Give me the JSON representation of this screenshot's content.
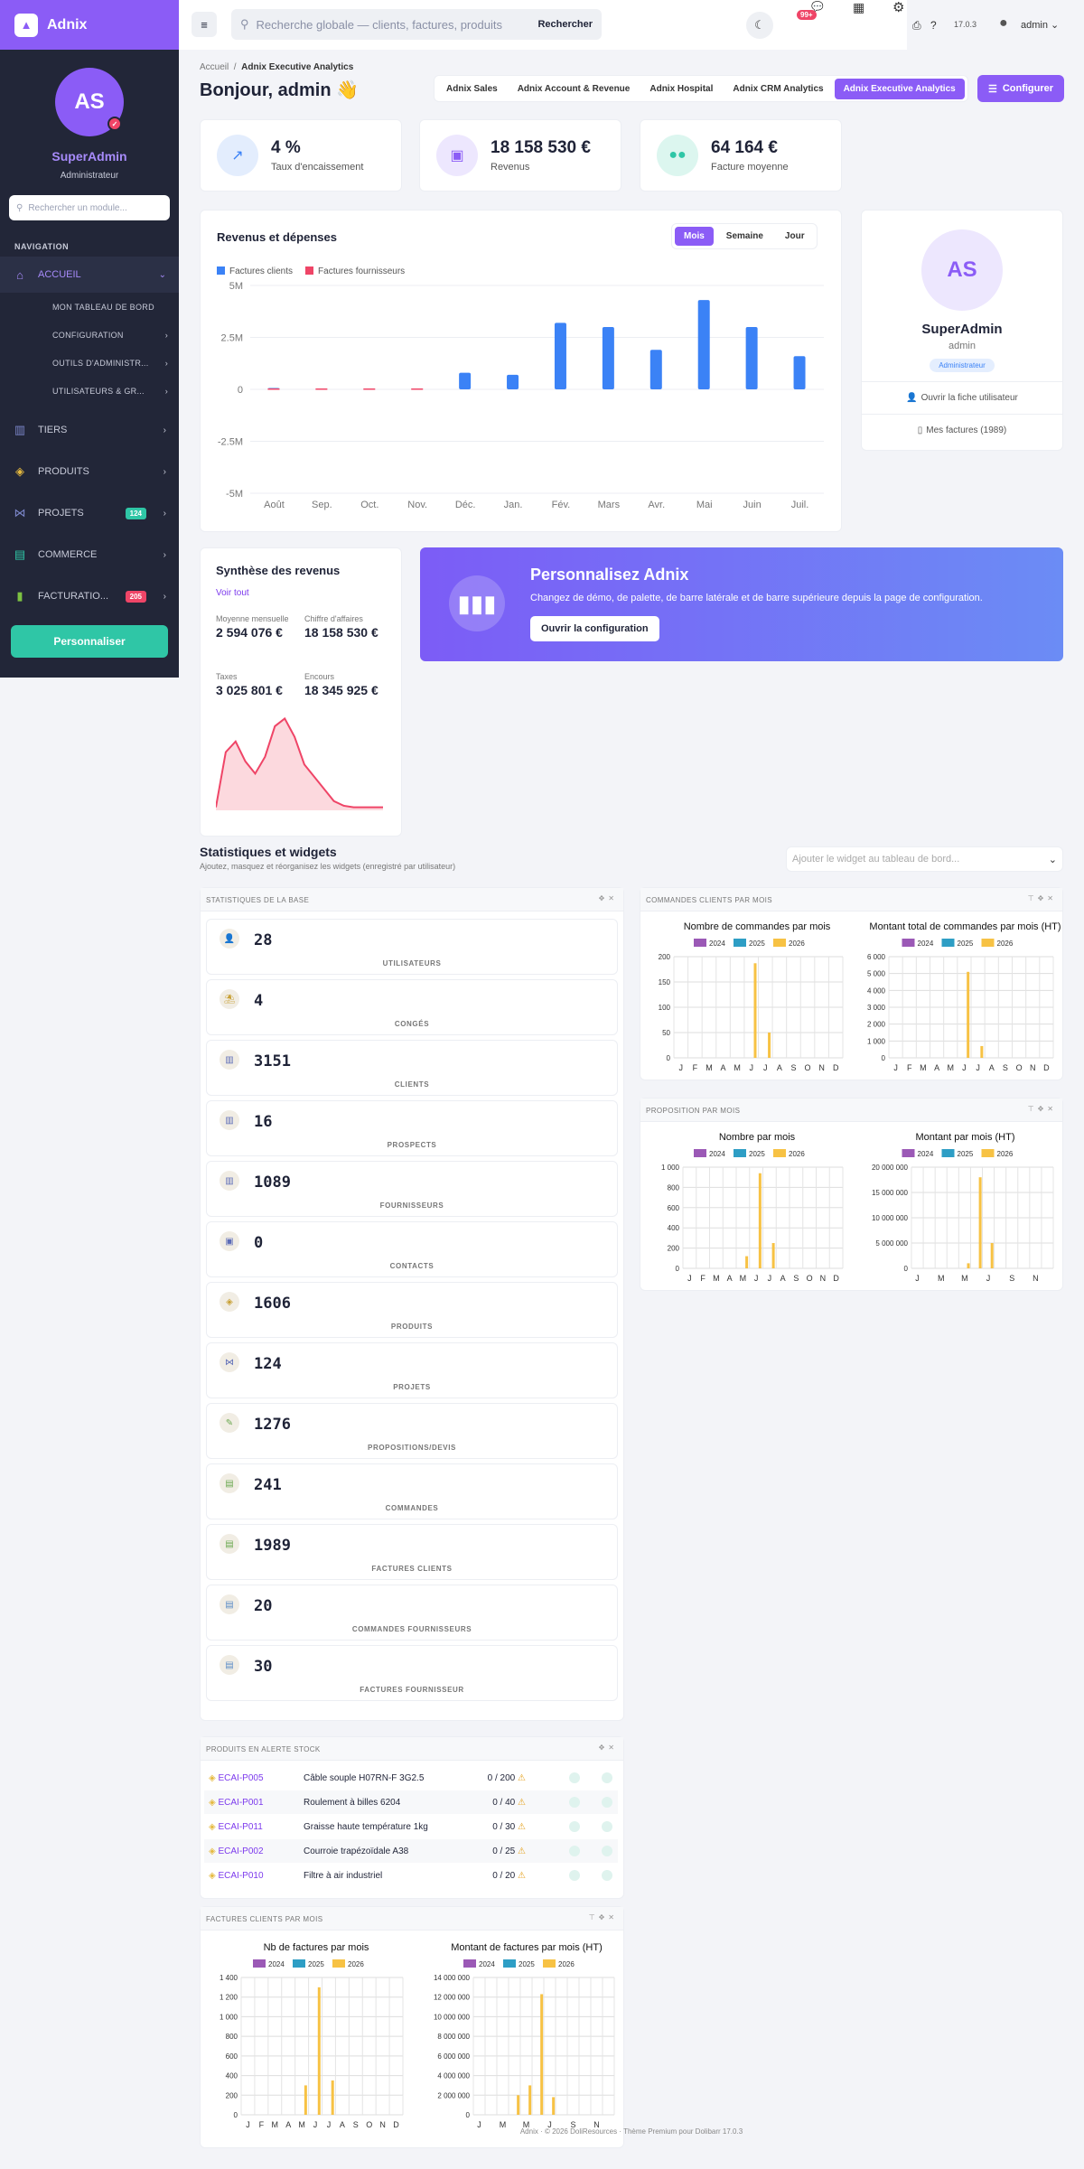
{
  "app": {
    "name": "Adnix"
  },
  "sidebar": {
    "avatar_initials": "AS",
    "user_name": "SuperAdmin",
    "user_role": "Administrateur",
    "search_placeholder": "Rechercher un module...",
    "section": "NAVIGATION",
    "items": [
      {
        "label": "ACCUEIL",
        "icon": "home-icon",
        "active": true
      },
      {
        "label": "TIERS",
        "icon": "building-icon"
      },
      {
        "label": "PRODUITS",
        "icon": "box-icon"
      },
      {
        "label": "PROJETS",
        "icon": "project-icon",
        "badge": "124"
      },
      {
        "label": "COMMERCE",
        "icon": "briefcase-icon"
      },
      {
        "label": "FACTURATIO...",
        "icon": "invoice-icon",
        "badge": "205"
      }
    ],
    "subitems": [
      "MON TABLEAU DE BORD",
      "CONFIGURATION",
      "OUTILS D'ADMINISTR...",
      "UTILISATEURS & GR..."
    ],
    "personalize_button": "Personnaliser"
  },
  "topbar": {
    "search_placeholder": "Recherche globale — clients, factures, produits",
    "search_button": "Rechercher",
    "notif_badge": "99+",
    "version": "17.0.3",
    "user": "admin"
  },
  "header": {
    "breadcrumb_home": "Accueil",
    "breadcrumb_current": "Adnix Executive Analytics",
    "greeting": "Bonjour, admin 👋",
    "tabs": [
      "Adnix Sales",
      "Adnix Account & Revenue",
      "Adnix Hospital",
      "Adnix CRM Analytics",
      "Adnix Executive Analytics"
    ],
    "configure_button": "Configurer"
  },
  "kpis": [
    {
      "value": "4 %",
      "label": "Taux d'encaissement",
      "color": "#3b82f6"
    },
    {
      "value": "18 158 530 €",
      "label": "Revenus",
      "color": "#8b5cf6"
    },
    {
      "value": "64 164 €",
      "label": "Facture moyenne",
      "color": "#2fc6a6"
    }
  ],
  "revenue_chart": {
    "title": "Revenus et dépenses",
    "periods": [
      "Mois",
      "Semaine",
      "Jour"
    ],
    "active_period": "Mois"
  },
  "chart_data": [
    {
      "type": "bar",
      "title": "Revenus et dépenses",
      "categories": [
        "Août",
        "Sep.",
        "Oct.",
        "Nov.",
        "Déc.",
        "Jan.",
        "Fév.",
        "Mars",
        "Avr.",
        "Mai",
        "Juin",
        "Juil."
      ],
      "series": [
        {
          "name": "Factures clients",
          "color": "#3b82f6",
          "values": [
            0.02,
            0,
            0,
            0,
            0.8,
            0.7,
            3.2,
            3.0,
            1.9,
            4.3,
            3.0,
            1.6
          ]
        },
        {
          "name": "Factures fournisseurs",
          "color": "#ef4567",
          "values": [
            0.02,
            0.02,
            0.02,
            0.02,
            0,
            0,
            0,
            0,
            0,
            0,
            0,
            0
          ]
        }
      ],
      "yticks": [
        "5M",
        "2.5M",
        "0",
        "-2.5M",
        "-5M"
      ],
      "ylim": [
        -5,
        5
      ],
      "unit": "M",
      "grid": true,
      "legend": "top-left"
    },
    {
      "type": "area",
      "title": "Synthèse des revenus",
      "values": [
        2,
        38,
        45,
        32,
        24,
        35,
        55,
        60,
        48,
        30,
        22,
        14,
        6,
        3,
        2,
        2,
        2,
        2
      ],
      "color": "#ef4567"
    },
    {
      "type": "bar",
      "title": "Nombre de commandes par mois",
      "categories": [
        "J",
        "F",
        "M",
        "A",
        "M",
        "J",
        "J",
        "A",
        "S",
        "O",
        "N",
        "D"
      ],
      "series": [
        {
          "name": "2024",
          "color": "#9b59b6",
          "values": [
            0,
            0,
            0,
            0,
            0,
            0,
            0,
            0,
            0,
            0,
            0,
            0
          ]
        },
        {
          "name": "2025",
          "color": "#2e9ec5",
          "values": [
            0,
            0,
            0,
            0,
            0,
            0,
            0,
            0,
            0,
            0,
            0,
            0
          ]
        },
        {
          "name": "2026",
          "color": "#f7c244",
          "values": [
            0,
            0,
            0,
            0,
            0,
            187,
            50,
            0,
            0,
            0,
            0,
            0
          ]
        }
      ],
      "yticks": [
        "200",
        "150",
        "100",
        "50",
        "0"
      ],
      "ylim": [
        0,
        200
      ]
    },
    {
      "type": "bar",
      "title": "Montant total de commandes par mois (HT)",
      "categories": [
        "J",
        "F",
        "M",
        "A",
        "M",
        "J",
        "J",
        "A",
        "S",
        "O",
        "N",
        "D"
      ],
      "series": [
        {
          "name": "2024",
          "color": "#9b59b6",
          "values": [
            0,
            0,
            0,
            0,
            0,
            0,
            0,
            0,
            0,
            0,
            0,
            0
          ]
        },
        {
          "name": "2025",
          "color": "#2e9ec5",
          "values": [
            0,
            0,
            0,
            0,
            0,
            0,
            0,
            0,
            0,
            0,
            0,
            0
          ]
        },
        {
          "name": "2026",
          "color": "#f7c244",
          "values": [
            0,
            0,
            0,
            0,
            0,
            5100,
            700,
            0,
            0,
            0,
            0,
            0
          ]
        }
      ],
      "yticks": [
        "6 000",
        "5 000",
        "4 000",
        "3 000",
        "2 000",
        "1 000",
        "0"
      ],
      "ylim": [
        0,
        6000
      ]
    },
    {
      "type": "bar",
      "title": "Nombre par mois",
      "categories": [
        "J",
        "F",
        "M",
        "A",
        "M",
        "J",
        "J",
        "A",
        "S",
        "O",
        "N",
        "D"
      ],
      "series": [
        {
          "name": "2024",
          "color": "#9b59b6",
          "values": [
            0,
            0,
            0,
            0,
            0,
            0,
            0,
            0,
            0,
            0,
            0,
            0
          ]
        },
        {
          "name": "2025",
          "color": "#2e9ec5",
          "values": [
            0,
            0,
            0,
            0,
            0,
            0,
            0,
            0,
            0,
            0,
            0,
            0
          ]
        },
        {
          "name": "2026",
          "color": "#f7c244",
          "values": [
            0,
            0,
            0,
            0,
            120,
            940,
            250,
            0,
            0,
            0,
            0,
            0
          ]
        }
      ],
      "yticks": [
        "1 000",
        "800",
        "600",
        "400",
        "200",
        "0"
      ],
      "ylim": [
        0,
        1000
      ]
    },
    {
      "type": "bar",
      "title": "Montant par mois (HT)",
      "categories": [
        "J",
        "M",
        "M",
        "J",
        "S",
        "N"
      ],
      "series": [
        {
          "name": "2024",
          "color": "#9b59b6",
          "values": [
            0,
            0,
            0,
            0,
            0,
            0,
            0,
            0,
            0,
            0,
            0,
            0
          ]
        },
        {
          "name": "2025",
          "color": "#2e9ec5",
          "values": [
            0,
            0,
            0,
            0,
            0,
            0,
            0,
            0,
            0,
            0,
            0,
            0
          ]
        },
        {
          "name": "2026",
          "color": "#f7c244",
          "values": [
            0,
            0,
            0,
            0,
            1000000,
            18000000,
            5000000,
            0,
            0,
            0,
            0,
            0
          ]
        }
      ],
      "yticks": [
        "20 000 000",
        "15 000 000",
        "10 000 000",
        "5 000 000",
        "0"
      ],
      "ylim": [
        0,
        20000000
      ]
    },
    {
      "type": "bar",
      "title": "Nb de factures par mois",
      "categories": [
        "J",
        "F",
        "M",
        "A",
        "M",
        "J",
        "J",
        "A",
        "S",
        "O",
        "N",
        "D"
      ],
      "series": [
        {
          "name": "2024",
          "color": "#9b59b6",
          "values": [
            0,
            0,
            0,
            0,
            0,
            0,
            0,
            0,
            0,
            0,
            0,
            0
          ]
        },
        {
          "name": "2025",
          "color": "#2e9ec5",
          "values": [
            0,
            0,
            0,
            0,
            0,
            0,
            0,
            0,
            0,
            0,
            0,
            0
          ]
        },
        {
          "name": "2026",
          "color": "#f7c244",
          "values": [
            0,
            0,
            0,
            0,
            300,
            1300,
            350,
            0,
            0,
            0,
            0,
            0
          ]
        }
      ],
      "yticks": [
        "1 400",
        "1 200",
        "1 000",
        "800",
        "600",
        "400",
        "200",
        "0"
      ],
      "ylim": [
        0,
        1400
      ]
    },
    {
      "type": "bar",
      "title": "Montant de factures par mois (HT)",
      "categories": [
        "J",
        "M",
        "M",
        "J",
        "S",
        "N"
      ],
      "series": [
        {
          "name": "2024",
          "color": "#9b59b6",
          "values": [
            0,
            0,
            0,
            0,
            0,
            0,
            0,
            0,
            0,
            0,
            0,
            0
          ]
        },
        {
          "name": "2025",
          "color": "#2e9ec5",
          "values": [
            0,
            0,
            0,
            0,
            0,
            0,
            0,
            0,
            0,
            0,
            0,
            0
          ]
        },
        {
          "name": "2026",
          "color": "#f7c244",
          "values": [
            0,
            0,
            0,
            2000000,
            3000000,
            12300000,
            1800000,
            0,
            0,
            0,
            0,
            0
          ]
        }
      ],
      "yticks": [
        "14 000 000",
        "12 000 000",
        "10 000 000",
        "8 000 000",
        "6 000 000",
        "4 000 000",
        "2 000 000",
        "0"
      ],
      "ylim": [
        0,
        14000000
      ]
    }
  ],
  "profile_card": {
    "initials": "AS",
    "name": "SuperAdmin",
    "login": "admin",
    "role_tag": "Administrateur",
    "link_profile": "Ouvrir la fiche utilisateur",
    "link_invoices": "Mes factures (1989)"
  },
  "synthese": {
    "title": "Synthèse des revenus",
    "view_all": "Voir tout",
    "items": [
      {
        "label": "Moyenne mensuelle",
        "value": "2 594 076 €"
      },
      {
        "label": "Chiffre d'affaires",
        "value": "18 158 530 €"
      },
      {
        "label": "Taxes",
        "value": "3 025 801 €"
      },
      {
        "label": "Encours",
        "value": "18 345 925 €"
      }
    ]
  },
  "promo": {
    "title": "Personnalisez Adnix",
    "text": "Changez de démo, de palette, de barre latérale et de barre supérieure depuis la page de configuration.",
    "button": "Ouvrir la configuration"
  },
  "widgets": {
    "title": "Statistiques et widgets",
    "subtitle": "Ajoutez, masquez et réorganisez les widgets (enregistré par utilisateur)",
    "add_placeholder": "Ajouter le widget au tableau de bord...",
    "base_stats_title": "STATISTIQUES DE LA BASE",
    "stats": [
      {
        "value": "28",
        "label": "UTILISATEURS",
        "icon": "user-icon"
      },
      {
        "value": "4",
        "label": "CONGÉS",
        "icon": "beach-icon"
      },
      {
        "value": "3151",
        "label": "CLIENTS",
        "icon": "building-icon"
      },
      {
        "value": "16",
        "label": "PROSPECTS",
        "icon": "building-icon"
      },
      {
        "value": "1089",
        "label": "FOURNISSEURS",
        "icon": "building-icon"
      },
      {
        "value": "0",
        "label": "CONTACTS",
        "icon": "contact-icon"
      },
      {
        "value": "1606",
        "label": "PRODUITS",
        "icon": "box-icon"
      },
      {
        "value": "124",
        "label": "PROJETS",
        "icon": "project-icon"
      },
      {
        "value": "1276",
        "label": "PROPOSITIONS/DEVIS",
        "icon": "proposal-icon"
      },
      {
        "value": "241",
        "label": "COMMANDES",
        "icon": "order-icon"
      },
      {
        "value": "1989",
        "label": "FACTURES CLIENTS",
        "icon": "invoice-icon"
      },
      {
        "value": "20",
        "label": "COMMANDES FOURNISSEURS",
        "icon": "order-icon"
      },
      {
        "value": "30",
        "label": "FACTURES FOURNISSEUR",
        "icon": "invoice-icon"
      }
    ],
    "orders_title": "COMMANDES CLIENTS PAR MOIS",
    "proposals_title": "PROPOSITION PAR MOIS",
    "stock_title": "PRODUITS EN ALERTE STOCK",
    "stock_rows": [
      {
        "ref": "ECAI-P005",
        "label": "Câble souple H07RN-F 3G2.5",
        "qty": "0 / 200"
      },
      {
        "ref": "ECAI-P001",
        "label": "Roulement à billes 6204",
        "qty": "0 / 40"
      },
      {
        "ref": "ECAI-P011",
        "label": "Graisse haute température 1kg",
        "qty": "0 / 30"
      },
      {
        "ref": "ECAI-P002",
        "label": "Courroie trapézoïdale A38",
        "qty": "0 / 25"
      },
      {
        "ref": "ECAI-P010",
        "label": "Filtre à air industriel",
        "qty": "0 / 20"
      }
    ],
    "invoices_title": "FACTURES CLIENTS PAR MOIS",
    "year_legend": [
      "2024",
      "2025",
      "2026"
    ]
  },
  "footer": "Adnix · © 2026 DoliResources · Thème Premium pour Dolibarr 17.0.3"
}
